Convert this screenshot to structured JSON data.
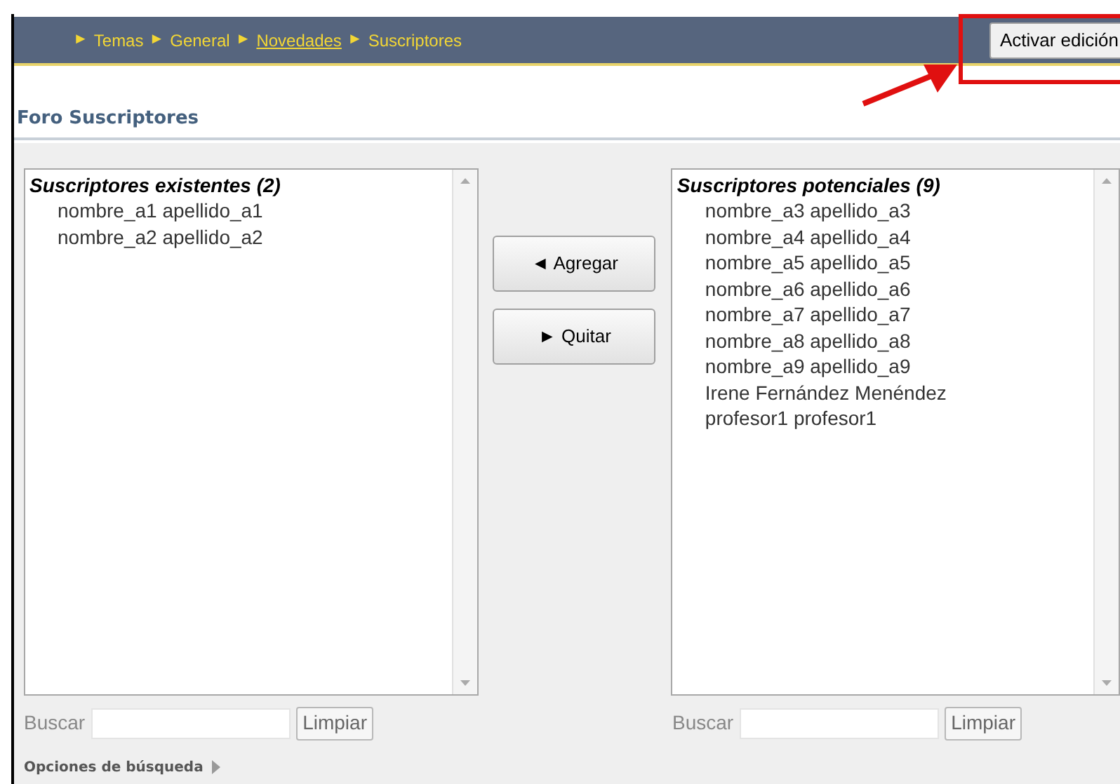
{
  "breadcrumb": [
    {
      "separator": "►",
      "label": "Temas",
      "link": false
    },
    {
      "separator": "►",
      "label": "General",
      "link": false
    },
    {
      "separator": "►",
      "label": "Novedades",
      "link": true
    },
    {
      "separator": "►",
      "label": "Suscriptores",
      "link": false
    }
  ],
  "edit_button": "Activar edición",
  "title": "Foro Suscriptores",
  "lists": [
    {
      "heading": "Suscriptores existentes (2)",
      "members": [
        "nombre_a1 apellido_a1",
        "nombre_a2 apellido_a2"
      ]
    },
    {
      "heading": "Suscriptores potenciales (9)",
      "members": [
        "nombre_a3 apellido_a3",
        "nombre_a4 apellido_a4",
        "nombre_a5 apellido_a5",
        "nombre_a6 apellido_a6",
        "nombre_a7 apellido_a7",
        "nombre_a8 apellido_a8",
        "nombre_a9 apellido_a9",
        "Irene Fernández Menéndez",
        "profesor1 profesor1"
      ]
    }
  ],
  "buttons": [
    {
      "arrow": "◄",
      "label": "Agregar"
    },
    {
      "arrow": "►",
      "label": "Quitar"
    }
  ],
  "searches": [
    {
      "label": "Buscar",
      "button": "Limpiar"
    },
    {
      "label": "Buscar",
      "button": "Limpiar"
    }
  ],
  "search_options": "Opciones de búsqueda"
}
